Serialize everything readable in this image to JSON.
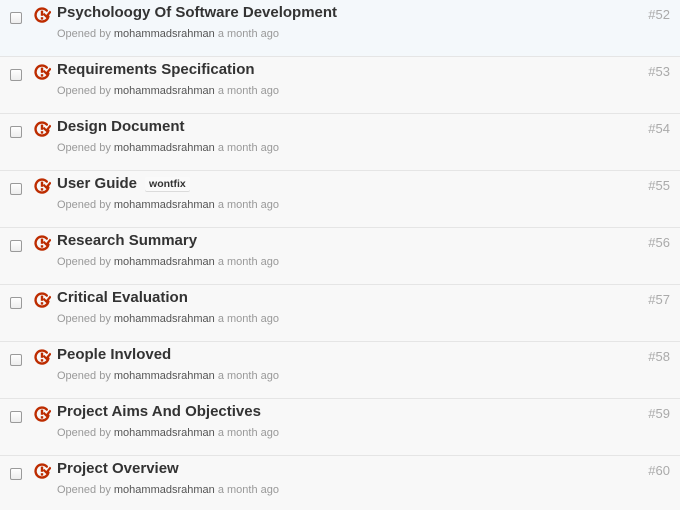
{
  "issues": [
    {
      "title": "Psycholoogy Of Software Development",
      "number": "#52",
      "opened_by": "Opened by",
      "author": "mohammadsrahman",
      "time": "a month ago",
      "label": "",
      "icon": "closed-issue-icon"
    },
    {
      "title": "Requirements Specification",
      "number": "#53",
      "opened_by": "Opened by",
      "author": "mohammadsrahman",
      "time": "a month ago",
      "label": "",
      "icon": "closed-issue-icon"
    },
    {
      "title": "Design Document",
      "number": "#54",
      "opened_by": "Opened by",
      "author": "mohammadsrahman",
      "time": "a month ago",
      "label": "",
      "icon": "closed-issue-icon"
    },
    {
      "title": "User Guide",
      "number": "#55",
      "opened_by": "Opened by",
      "author": "mohammadsrahman",
      "time": "a month ago",
      "label": "wontfix",
      "icon": "closed-issue-icon"
    },
    {
      "title": "Research Summary",
      "number": "#56",
      "opened_by": "Opened by",
      "author": "mohammadsrahman",
      "time": "a month ago",
      "label": "",
      "icon": "closed-issue-icon"
    },
    {
      "title": "Critical Evaluation",
      "number": "#57",
      "opened_by": "Opened by",
      "author": "mohammadsrahman",
      "time": "a month ago",
      "label": "",
      "icon": "closed-issue-icon"
    },
    {
      "title": "People Invloved",
      "number": "#58",
      "opened_by": "Opened by",
      "author": "mohammadsrahman",
      "time": "a month ago",
      "label": "",
      "icon": "closed-issue-icon"
    },
    {
      "title": "Project Aims And Objectives",
      "number": "#59",
      "opened_by": "Opened by",
      "author": "mohammadsrahman",
      "time": "a month ago",
      "label": "",
      "icon": "closed-issue-icon"
    },
    {
      "title": "Project Overview",
      "number": "#60",
      "opened_by": "Opened by",
      "author": "mohammadsrahman",
      "time": "a month ago",
      "label": "",
      "icon": "closed-issue-icon"
    }
  ],
  "colors": {
    "closed_icon": "#bd2c00",
    "title_text": "#333333",
    "meta_text": "#999999",
    "number_text": "#aaaaaa"
  }
}
